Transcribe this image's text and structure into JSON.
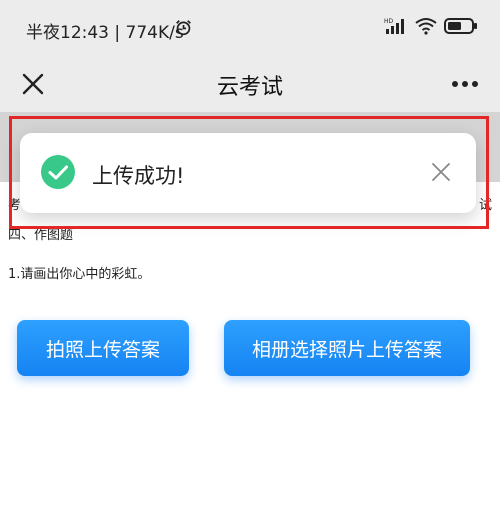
{
  "status_bar": {
    "time_text": "半夜12:43 | 774K/s",
    "icons": [
      "alarm-icon",
      "signal-icon",
      "wifi-icon",
      "battery-icon"
    ]
  },
  "nav": {
    "title": "云考试",
    "close_icon": "close-icon",
    "more_icon": "more-icon"
  },
  "content": {
    "under_left": "考",
    "under_right": "试",
    "section_title": "四、作图题",
    "question": "1.请画出你心中的彩虹。"
  },
  "buttons": {
    "camera_label": "拍照上传答案",
    "album_label": "相册选择照片上传答案"
  },
  "toast": {
    "message": "上传成功!",
    "icon": "success-check-icon",
    "close_icon": "close-icon"
  },
  "colors": {
    "accent": "#1583f2",
    "success": "#38c98a",
    "highlight": "#e32626"
  }
}
